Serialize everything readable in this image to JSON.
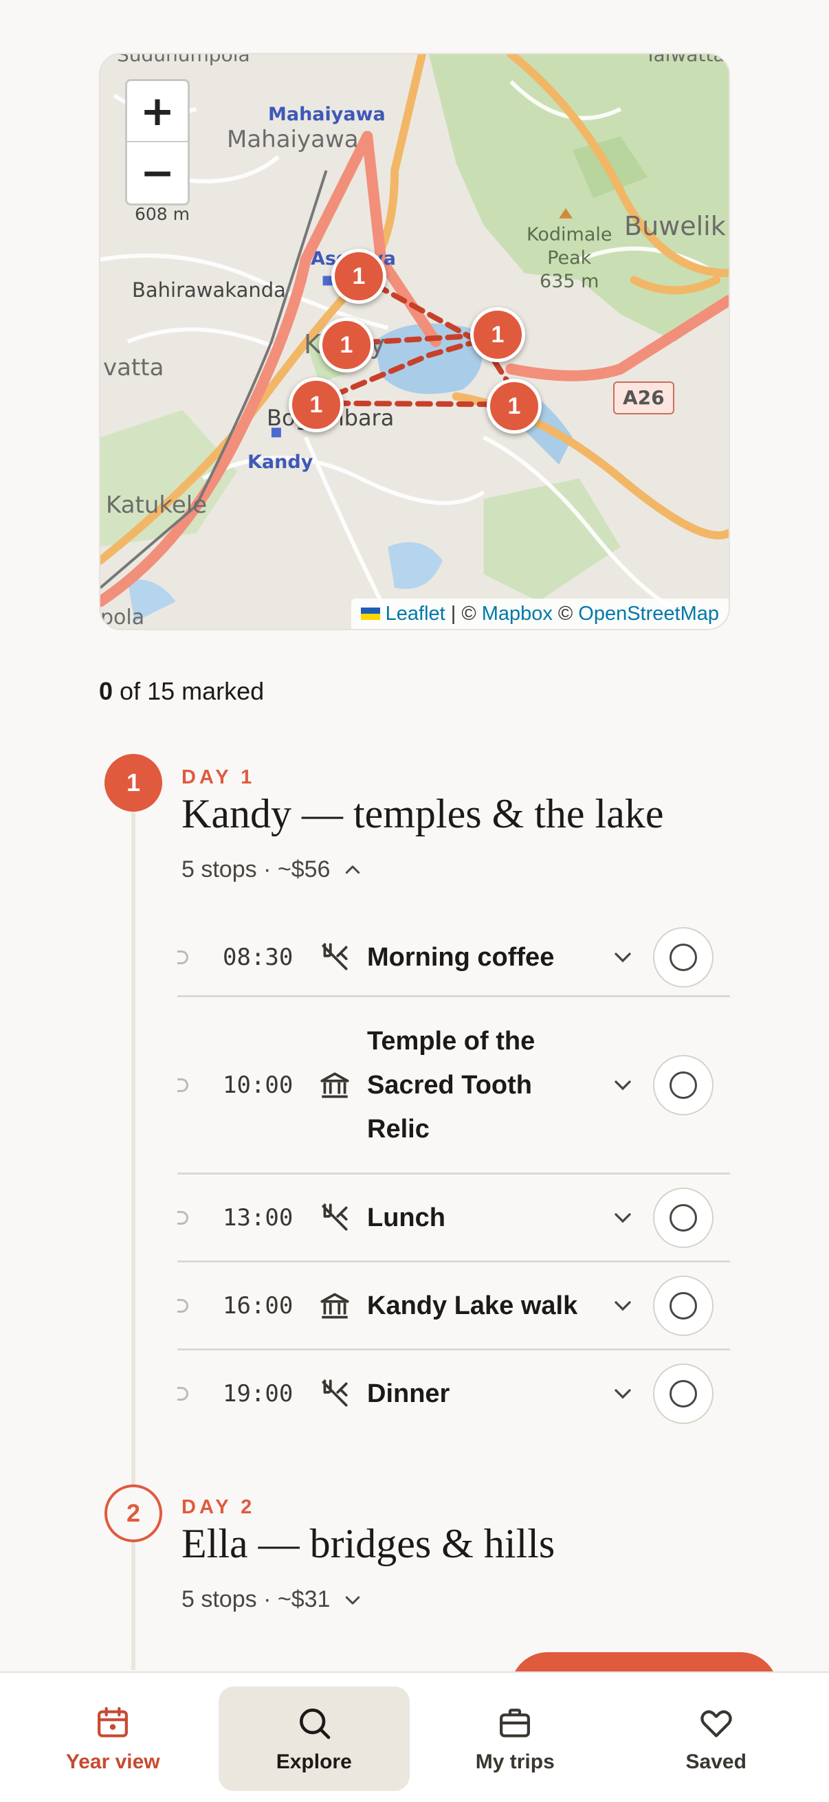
{
  "map": {
    "zoom_in": "+",
    "zoom_out": "−",
    "labels": {
      "mahaiyawa_top": "Mahaiyawa",
      "mahaiyawa": "Mahaiyawa",
      "elevation_608": "608 m",
      "kodimale": "Kodimale\nPeak\n635 m",
      "buwelik": "Buwelik",
      "bahirawakanda": "Bahirawakanda",
      "asgiriya": "Asgiriya",
      "kandy_town": "Kandy",
      "vatta": "vatta",
      "bogambara": "Bogambara",
      "kandy_station": "Kandy",
      "katukele": "Katukele",
      "polla": "pola",
      "suduhumpola": "Suduhumpola",
      "talwatta": "Talwatta",
      "road_shield": "A26"
    },
    "markers": [
      "1",
      "1",
      "1",
      "1",
      "1"
    ],
    "attribution": {
      "leaflet": "Leaflet",
      "sep1": "| ©",
      "mapbox": "Mapbox",
      "sep2": "©",
      "osm": "OpenStreetMap"
    }
  },
  "progress": {
    "marked": "0",
    "rest": "of 15 marked"
  },
  "days": [
    {
      "badge": "1",
      "kicker": "DAY 1",
      "title": "Kandy — temples & the lake",
      "meta": "5 stops · ~$56",
      "expanded": true,
      "stops": [
        {
          "time": "08:30",
          "icon": "restaurant-icon",
          "name": "Morning coffee"
        },
        {
          "time": "10:00",
          "icon": "temple-icon",
          "name": "Temple of the Sacred Tooth Relic"
        },
        {
          "time": "13:00",
          "icon": "restaurant-icon",
          "name": "Lunch"
        },
        {
          "time": "16:00",
          "icon": "temple-icon",
          "name": "Kandy Lake walk"
        },
        {
          "time": "19:00",
          "icon": "restaurant-icon",
          "name": "Dinner"
        }
      ]
    },
    {
      "badge": "2",
      "kicker": "DAY 2",
      "title": "Ella — bridges & hills",
      "meta": "5 stops · ~$31",
      "expanded": false
    }
  ],
  "nav": {
    "items": [
      {
        "label": "Year view",
        "icon": "calendar-icon"
      },
      {
        "label": "Explore",
        "icon": "search-icon"
      },
      {
        "label": "My trips",
        "icon": "briefcase-icon"
      },
      {
        "label": "Saved",
        "icon": "heart-icon"
      }
    ]
  },
  "colors": {
    "accent": "#e05a3e",
    "background": "#f9f8f6",
    "nav_selected_bg": "#ebe7df"
  }
}
